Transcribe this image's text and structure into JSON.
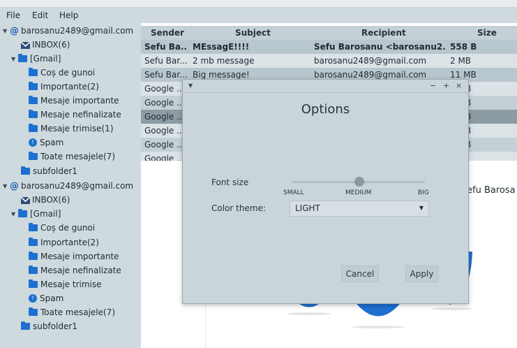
{
  "menu": {
    "file": "File",
    "edit": "Edit",
    "help": "Help"
  },
  "sidebar": {
    "account1": "barosanu2489@gmail.com",
    "inbox1": "INBOX(6)",
    "gmail1": "[Gmail]",
    "folders1": [
      "Coș de gunoi",
      "Importante(2)",
      "Mesaje importante",
      "Mesaje nefinalizate",
      "Mesaje trimise(1)",
      "Spam",
      "Toate mesajele(7)"
    ],
    "subfolder1": "subfolder1",
    "account2": "barosanu2489@gmail.com",
    "inbox2": "INBOX(6)",
    "gmail2": "[Gmail]",
    "folders2": [
      "Coș de gunoi",
      "Importante(2)",
      "Mesaje importante",
      "Mesaje nefinalizate",
      "Mesaje trimise",
      "Spam",
      "Toate mesajele(7)"
    ],
    "subfolder2": "subfolder1"
  },
  "table": {
    "headers": {
      "sender": "Sender",
      "subject": "Subject",
      "recipient": "Recipient",
      "size": "Size"
    },
    "rows": [
      {
        "sender": "Sefu Ba...",
        "subject": "MEssagE!!!!",
        "recipient": "Sefu Barosanu <barosanu2...",
        "size": "558 B"
      },
      {
        "sender": "Sefu Bar...",
        "subject": "2 mb message",
        "recipient": "barosanu2489@gmail.com",
        "size": "2 MB"
      },
      {
        "sender": "Sefu Bar...",
        "subject": "Big message!",
        "recipient": "barosanu2489@gmail.com",
        "size": "11 MB"
      },
      {
        "sender": "Google ...",
        "subject": "",
        "recipient": "",
        "size": "B"
      },
      {
        "sender": "Google ...",
        "subject": "",
        "recipient": "",
        "size": "B"
      },
      {
        "sender": "Google ...",
        "subject": "",
        "recipient": "",
        "size": "B"
      },
      {
        "sender": "Google ...",
        "subject": "",
        "recipient": "",
        "size": "B"
      },
      {
        "sender": "Google ...",
        "subject": "",
        "recipient": "",
        "size": "B"
      },
      {
        "sender": "Google ...",
        "subject": "",
        "recipient": "",
        "size": ""
      }
    ]
  },
  "preview": {
    "partial_text": "efu Barosa"
  },
  "dialog": {
    "title": "Options",
    "font_size_label": "Font size",
    "slider_ticks": {
      "small": "SMALL",
      "medium": "MEDIUM",
      "big": "BIG"
    },
    "slider_value": "MEDIUM",
    "color_theme_label": "Color theme:",
    "color_theme_value": "LIGHT",
    "cancel": "Cancel",
    "apply": "Apply",
    "controls": {
      "minimize": "−",
      "maximize": "+",
      "close": "×"
    }
  }
}
